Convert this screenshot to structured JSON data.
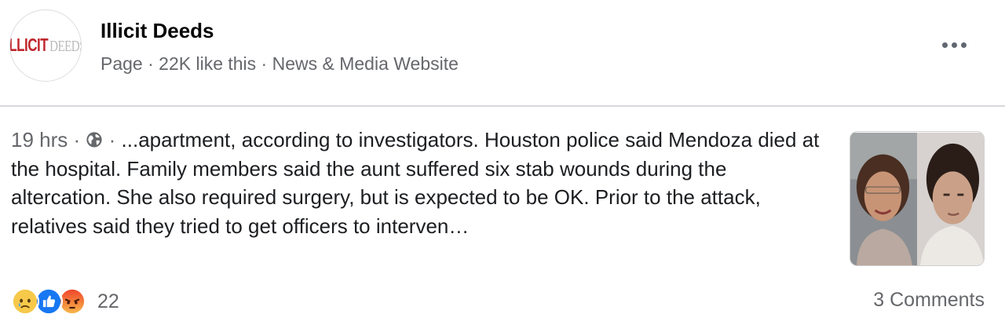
{
  "page": {
    "logo_text_1": "ILLICIT",
    "logo_text_2": "DEEDS",
    "name": "Illicit Deeds",
    "meta": "Page · 22K like this · News & Media Website"
  },
  "post": {
    "time": "19 hrs",
    "separator": "·",
    "privacy_icon": "globe-icon",
    "text": "...apartment, according to investigators. Houston police said Mendoza died at the hospital. Family members said the aunt suffered six stab wounds during the altercation. She also required surgery, but is expected to be OK. Prior to the attack, relatives said they tried to get officers to interven…"
  },
  "reactions": {
    "icons": [
      "sad-reaction-icon",
      "like-reaction-icon",
      "angry-reaction-icon"
    ],
    "count": "22"
  },
  "comments_label": "3 Comments",
  "colors": {
    "logo_red": "#c0262d",
    "like_blue": "#1877f2",
    "secondary_text": "#65676b"
  }
}
